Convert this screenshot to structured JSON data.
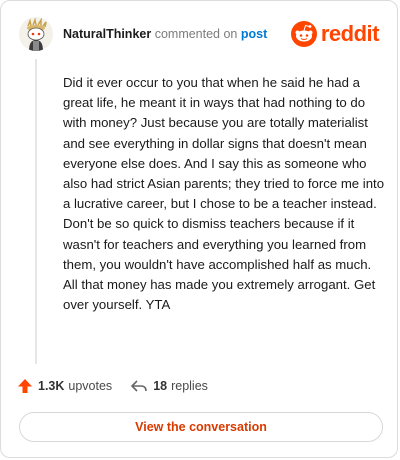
{
  "header": {
    "username": "NaturalThinker",
    "action_text": "commented on",
    "post_link": "post",
    "brand": "reddit"
  },
  "comment": {
    "text": "Did it ever occur to you that when he said he had a great life, he meant it in ways that had nothing to do with money? Just because you are totally materialist and see everything in dollar signs that doesn't mean everyone else does. And I say this as someone who also had strict Asian parents; they tried to force me into a lucrative career, but I chose to be a teacher instead. Don't be so quick to dismiss teachers because if it wasn't for teachers and everything you learned from them, you wouldn't have accomplished half as much. All that money has made you extremely arrogant. Get over yourself. YTA"
  },
  "actions": {
    "upvote_count": "1.3K",
    "upvote_label": "upvotes",
    "reply_count": "18",
    "reply_label": "replies"
  },
  "cta": {
    "label": "View the conversation"
  },
  "colors": {
    "brand": "#ff4500",
    "link": "#0079d3",
    "cta": "#d93a00"
  }
}
